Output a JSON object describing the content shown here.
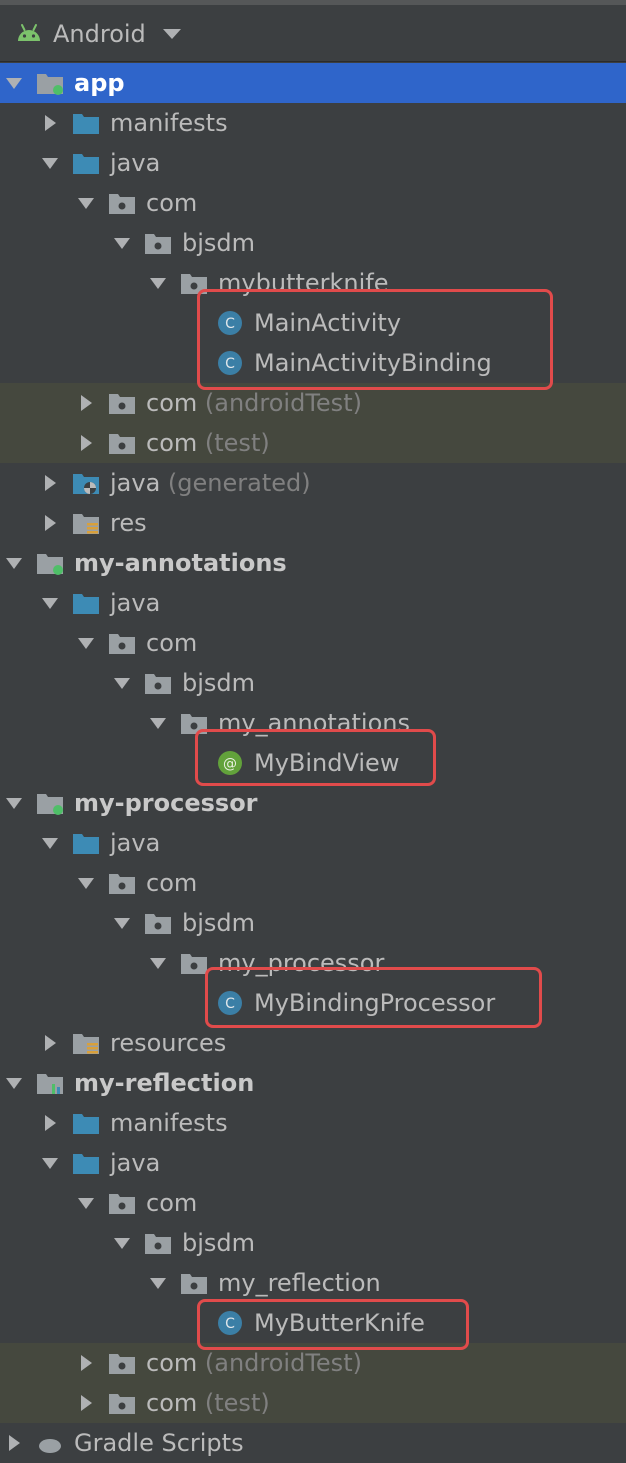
{
  "view_selector": {
    "label": "Android",
    "icon": "android-icon"
  },
  "colors": {
    "background": "#3c3f41",
    "selection": "#2f65ca",
    "test_tint": "#45483e",
    "highlight_box": "#e14b4b",
    "folder_blue": "#3d8bb5",
    "folder_gray": "#9aa0a4",
    "class_badge": "#3b7fa6",
    "annotation_badge": "#62a23b"
  },
  "tree": [
    {
      "depth": 0,
      "arrow": "expanded",
      "icon": "module-folder-icon",
      "label": "app",
      "bold": true,
      "selected": true
    },
    {
      "depth": 1,
      "arrow": "collapsed",
      "icon": "source-folder-icon",
      "label": "manifests"
    },
    {
      "depth": 1,
      "arrow": "expanded",
      "icon": "source-folder-icon",
      "label": "java"
    },
    {
      "depth": 2,
      "arrow": "expanded",
      "icon": "package-icon",
      "label": "com"
    },
    {
      "depth": 3,
      "arrow": "expanded",
      "icon": "package-icon",
      "label": "bjsdm"
    },
    {
      "depth": 4,
      "arrow": "expanded",
      "icon": "package-icon",
      "label": "mybutterknife"
    },
    {
      "depth": 5,
      "arrow": "none",
      "icon": "class-icon",
      "label": "MainActivity"
    },
    {
      "depth": 5,
      "arrow": "none",
      "icon": "class-icon",
      "label": "MainActivityBinding"
    },
    {
      "depth": 2,
      "arrow": "collapsed",
      "icon": "package-icon",
      "label": "com",
      "suffix": " (androidTest)",
      "tinted": true
    },
    {
      "depth": 2,
      "arrow": "collapsed",
      "icon": "package-icon",
      "label": "com",
      "suffix": " (test)",
      "tinted": true
    },
    {
      "depth": 1,
      "arrow": "collapsed",
      "icon": "generated-folder-icon",
      "label": "java",
      "suffix": " (generated)"
    },
    {
      "depth": 1,
      "arrow": "collapsed",
      "icon": "resource-folder-icon",
      "label": "res"
    },
    {
      "depth": 0,
      "arrow": "expanded",
      "icon": "module-folder-icon",
      "label": "my-annotations",
      "bold": true
    },
    {
      "depth": 1,
      "arrow": "expanded",
      "icon": "source-folder-icon",
      "label": "java"
    },
    {
      "depth": 2,
      "arrow": "expanded",
      "icon": "package-icon",
      "label": "com"
    },
    {
      "depth": 3,
      "arrow": "expanded",
      "icon": "package-icon",
      "label": "bjsdm"
    },
    {
      "depth": 4,
      "arrow": "expanded",
      "icon": "package-icon",
      "label": "my_annotations"
    },
    {
      "depth": 5,
      "arrow": "none",
      "icon": "annotation-icon",
      "label": "MyBindView"
    },
    {
      "depth": 0,
      "arrow": "expanded",
      "icon": "module-folder-icon",
      "label": "my-processor",
      "bold": true
    },
    {
      "depth": 1,
      "arrow": "expanded",
      "icon": "source-folder-icon",
      "label": "java"
    },
    {
      "depth": 2,
      "arrow": "expanded",
      "icon": "package-icon",
      "label": "com"
    },
    {
      "depth": 3,
      "arrow": "expanded",
      "icon": "package-icon",
      "label": "bjsdm"
    },
    {
      "depth": 4,
      "arrow": "expanded",
      "icon": "package-icon",
      "label": "my_processor"
    },
    {
      "depth": 5,
      "arrow": "none",
      "icon": "class-icon",
      "label": "MyBindingProcessor"
    },
    {
      "depth": 1,
      "arrow": "collapsed",
      "icon": "resource-folder-icon",
      "label": "resources"
    },
    {
      "depth": 0,
      "arrow": "expanded",
      "icon": "android-module-icon",
      "label": "my-reflection",
      "bold": true
    },
    {
      "depth": 1,
      "arrow": "collapsed",
      "icon": "source-folder-icon",
      "label": "manifests"
    },
    {
      "depth": 1,
      "arrow": "expanded",
      "icon": "source-folder-icon",
      "label": "java"
    },
    {
      "depth": 2,
      "arrow": "expanded",
      "icon": "package-icon",
      "label": "com"
    },
    {
      "depth": 3,
      "arrow": "expanded",
      "icon": "package-icon",
      "label": "bjsdm"
    },
    {
      "depth": 4,
      "arrow": "expanded",
      "icon": "package-icon",
      "label": "my_reflection"
    },
    {
      "depth": 5,
      "arrow": "none",
      "icon": "class-icon",
      "label": "MyButterKnife"
    },
    {
      "depth": 2,
      "arrow": "collapsed",
      "icon": "package-icon",
      "label": "com",
      "suffix": " (androidTest)",
      "tinted": true
    },
    {
      "depth": 2,
      "arrow": "collapsed",
      "icon": "package-icon",
      "label": "com",
      "suffix": " (test)",
      "tinted": true
    },
    {
      "depth": 0,
      "arrow": "collapsed",
      "icon": "gradle-icon",
      "label": "Gradle Scripts"
    }
  ]
}
